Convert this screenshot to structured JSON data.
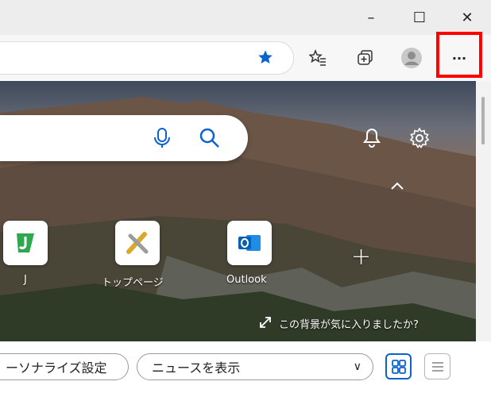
{
  "window": {
    "minimize_label": "–",
    "maximize_label": "☐",
    "close_label": "✕"
  },
  "toolbar": {
    "favorite_icon": "star-filled-icon",
    "favorites_icon": "favorites-list-icon",
    "collections_icon": "collections-icon",
    "profile_icon": "profile-avatar-icon",
    "more_label": "···",
    "accent": "#0b63ce",
    "highlight_color": "#ff0000"
  },
  "newtab": {
    "mic_icon": "microphone-icon",
    "search_icon": "search-icon",
    "bell_icon": "bell-icon",
    "settings_icon": "gear-icon",
    "collapse_icon": "chevron-up-icon",
    "tiles": [
      {
        "label": "J"
      },
      {
        "label": "トップページ"
      },
      {
        "label": "Outlook"
      }
    ],
    "add_label": "+",
    "background_question": "この背景が気に入りましたか?"
  },
  "bottom": {
    "personalize_label": "ーソナライズ設定",
    "news_label": "ニュースを表示",
    "news_chevron": "∨"
  }
}
